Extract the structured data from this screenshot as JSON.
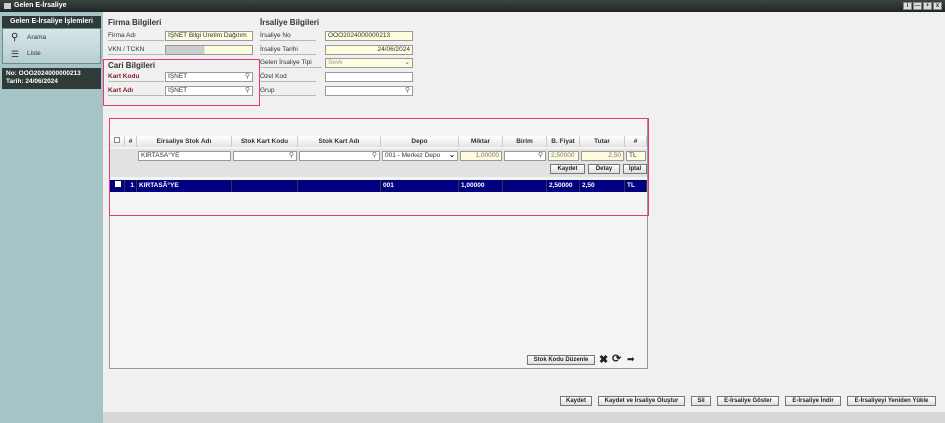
{
  "window": {
    "title": "Gelen E-İrsaliye",
    "controls": [
      "i",
      "—",
      "+",
      "x"
    ]
  },
  "sidebar": {
    "header": "Gelen E-İrsaliye İşlemleri",
    "items": [
      {
        "label": "Arama",
        "icon": "search-icon"
      },
      {
        "label": "Liste",
        "icon": "list-icon"
      }
    ],
    "info_no": "No: OOO2024000000213",
    "info_date": "Tarih: 24/06/2024"
  },
  "firma": {
    "title": "Firma Bilgileri",
    "firma_adi_label": "Firma Adı",
    "firma_adi": "İŞNET Bilgi Üretim Dağıtım",
    "vkn_label": "VKN / TCKN",
    "vkn": ""
  },
  "cari": {
    "title": "Cari Bilgileri",
    "kart_kodu_label": "Kart Kodu",
    "kart_kodu": "İŞNET",
    "kart_adi_label": "Kart Adı",
    "kart_adi": "İŞNET"
  },
  "irsaliye": {
    "title": "İrsaliye Bilgileri",
    "no_label": "İrsaliye No",
    "no": "OOO2024000000213",
    "tarih_label": "İrsaliye Tarihi",
    "tarih": "24/06/2024",
    "tip_label": "Gelen İrsaliye Tipi",
    "tip": "Sevk",
    "ozel_kod_label": "Özel Kod",
    "ozel_kod": "",
    "grup_label": "Grup",
    "grup": ""
  },
  "grid": {
    "columns": [
      "#",
      "Eirsaliye Stok Adı",
      "Stok Kart Kodu",
      "Stok Kart Adı",
      "Depo",
      "Miktar",
      "Birim",
      "B. Fiyat",
      "Tutar",
      "#"
    ],
    "edit": {
      "stok_adi": "KIRTASÃ°YE",
      "stok_kodu": "",
      "stok_kart_adi": "",
      "depo": "001 - Merkez Depo",
      "miktar": "1,00000",
      "birim": "",
      "fiyat": "2,50000",
      "tutar": "2,50",
      "doviz": "TL"
    },
    "edit_buttons": {
      "save": "Kaydet",
      "detail": "Detay",
      "cancel": "İptal"
    },
    "rows": [
      [
        "1",
        "KIRTASÃ°YE",
        "",
        "",
        "001",
        "1,00000",
        "",
        "2,50000",
        "2,50",
        "TL"
      ]
    ],
    "stok_kodu_button": "Stok Kodu Düzenle"
  },
  "actions": [
    "Kaydet",
    "Kaydet ve İrsaliye Oluştur",
    "Sil",
    "E-İrsaliye Göster",
    "E-İrsaliye İndir",
    "E-İrsaliyeyi Yeniden Yükle"
  ],
  "colors": {
    "highlight": "#e8357f",
    "selected_row": "#000080",
    "sidebar": "#a6c3c5"
  }
}
